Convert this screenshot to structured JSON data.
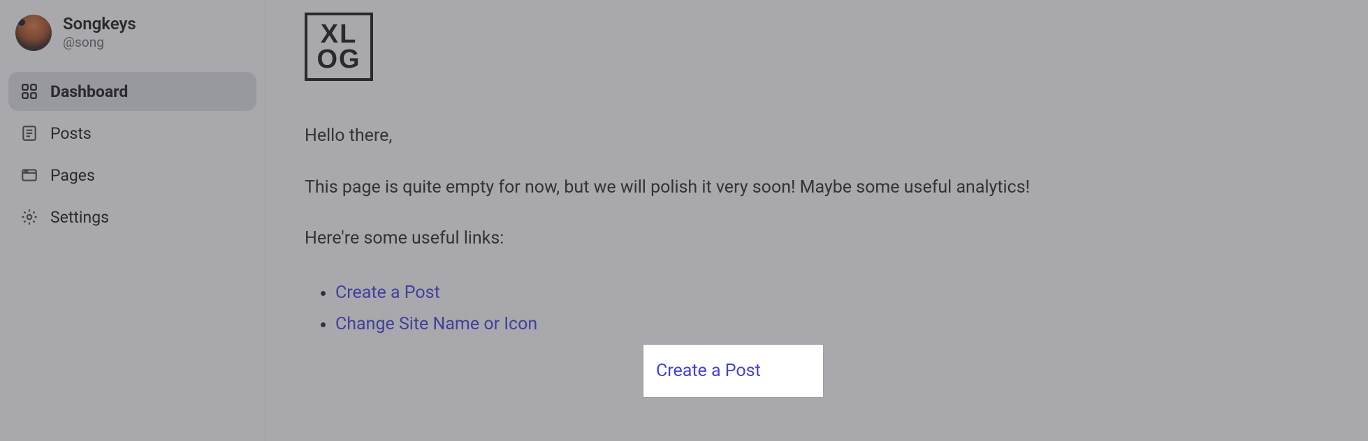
{
  "user": {
    "name": "Songkeys",
    "handle": "@song"
  },
  "sidebar": {
    "items": [
      {
        "label": "Dashboard",
        "icon": "dashboard-icon",
        "active": true
      },
      {
        "label": "Posts",
        "icon": "posts-icon",
        "active": false
      },
      {
        "label": "Pages",
        "icon": "pages-icon",
        "active": false
      },
      {
        "label": "Settings",
        "icon": "settings-icon",
        "active": false
      }
    ]
  },
  "logo": {
    "line1": "XL",
    "line2": "OG"
  },
  "content": {
    "greeting": "Hello there,",
    "body": "This page is quite empty for now, but we will polish it very soon! Maybe some useful analytics!",
    "links_intro": "Here're some useful links:",
    "links": [
      {
        "label": "Create a Post"
      },
      {
        "label": "Change Site Name or Icon"
      }
    ]
  },
  "highlighted_link": "Create a Post"
}
